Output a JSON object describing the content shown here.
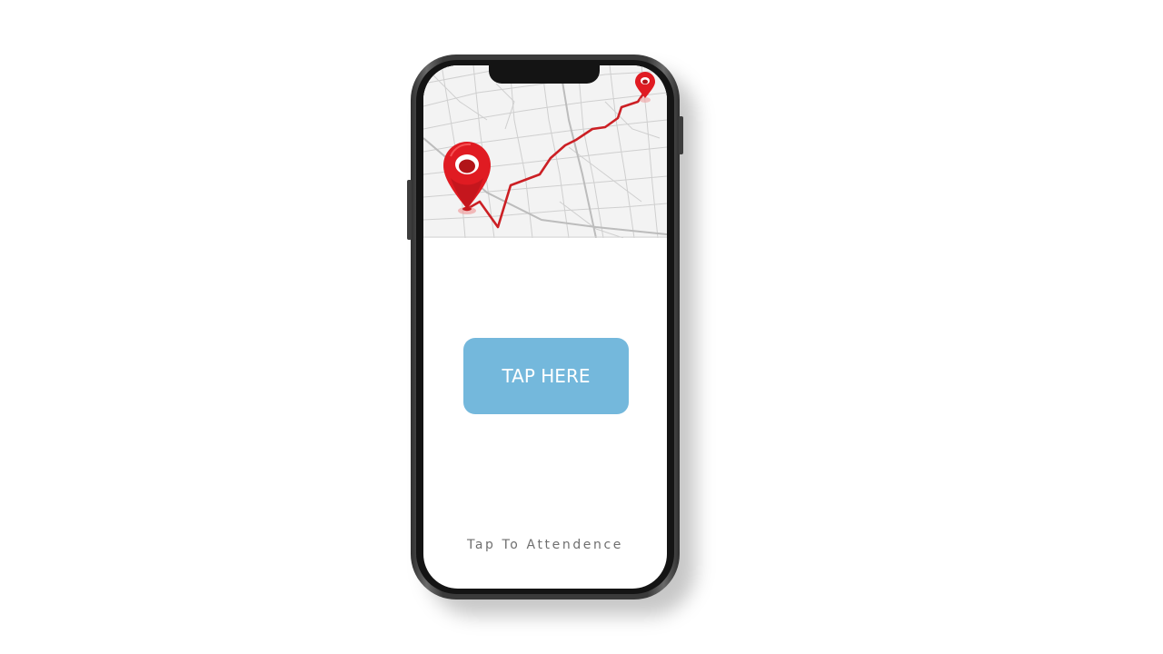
{
  "screen": {
    "map_icon": "map-route-icon",
    "start_pin_icon": "location-pin-icon",
    "end_pin_icon": "location-pin-icon",
    "route_color": "#cc1f24",
    "pin_color": "#e01b22"
  },
  "action_button": {
    "label": "TAP HERE",
    "color": "#74b8dc"
  },
  "caption": {
    "text": "Tap To Attendence"
  }
}
